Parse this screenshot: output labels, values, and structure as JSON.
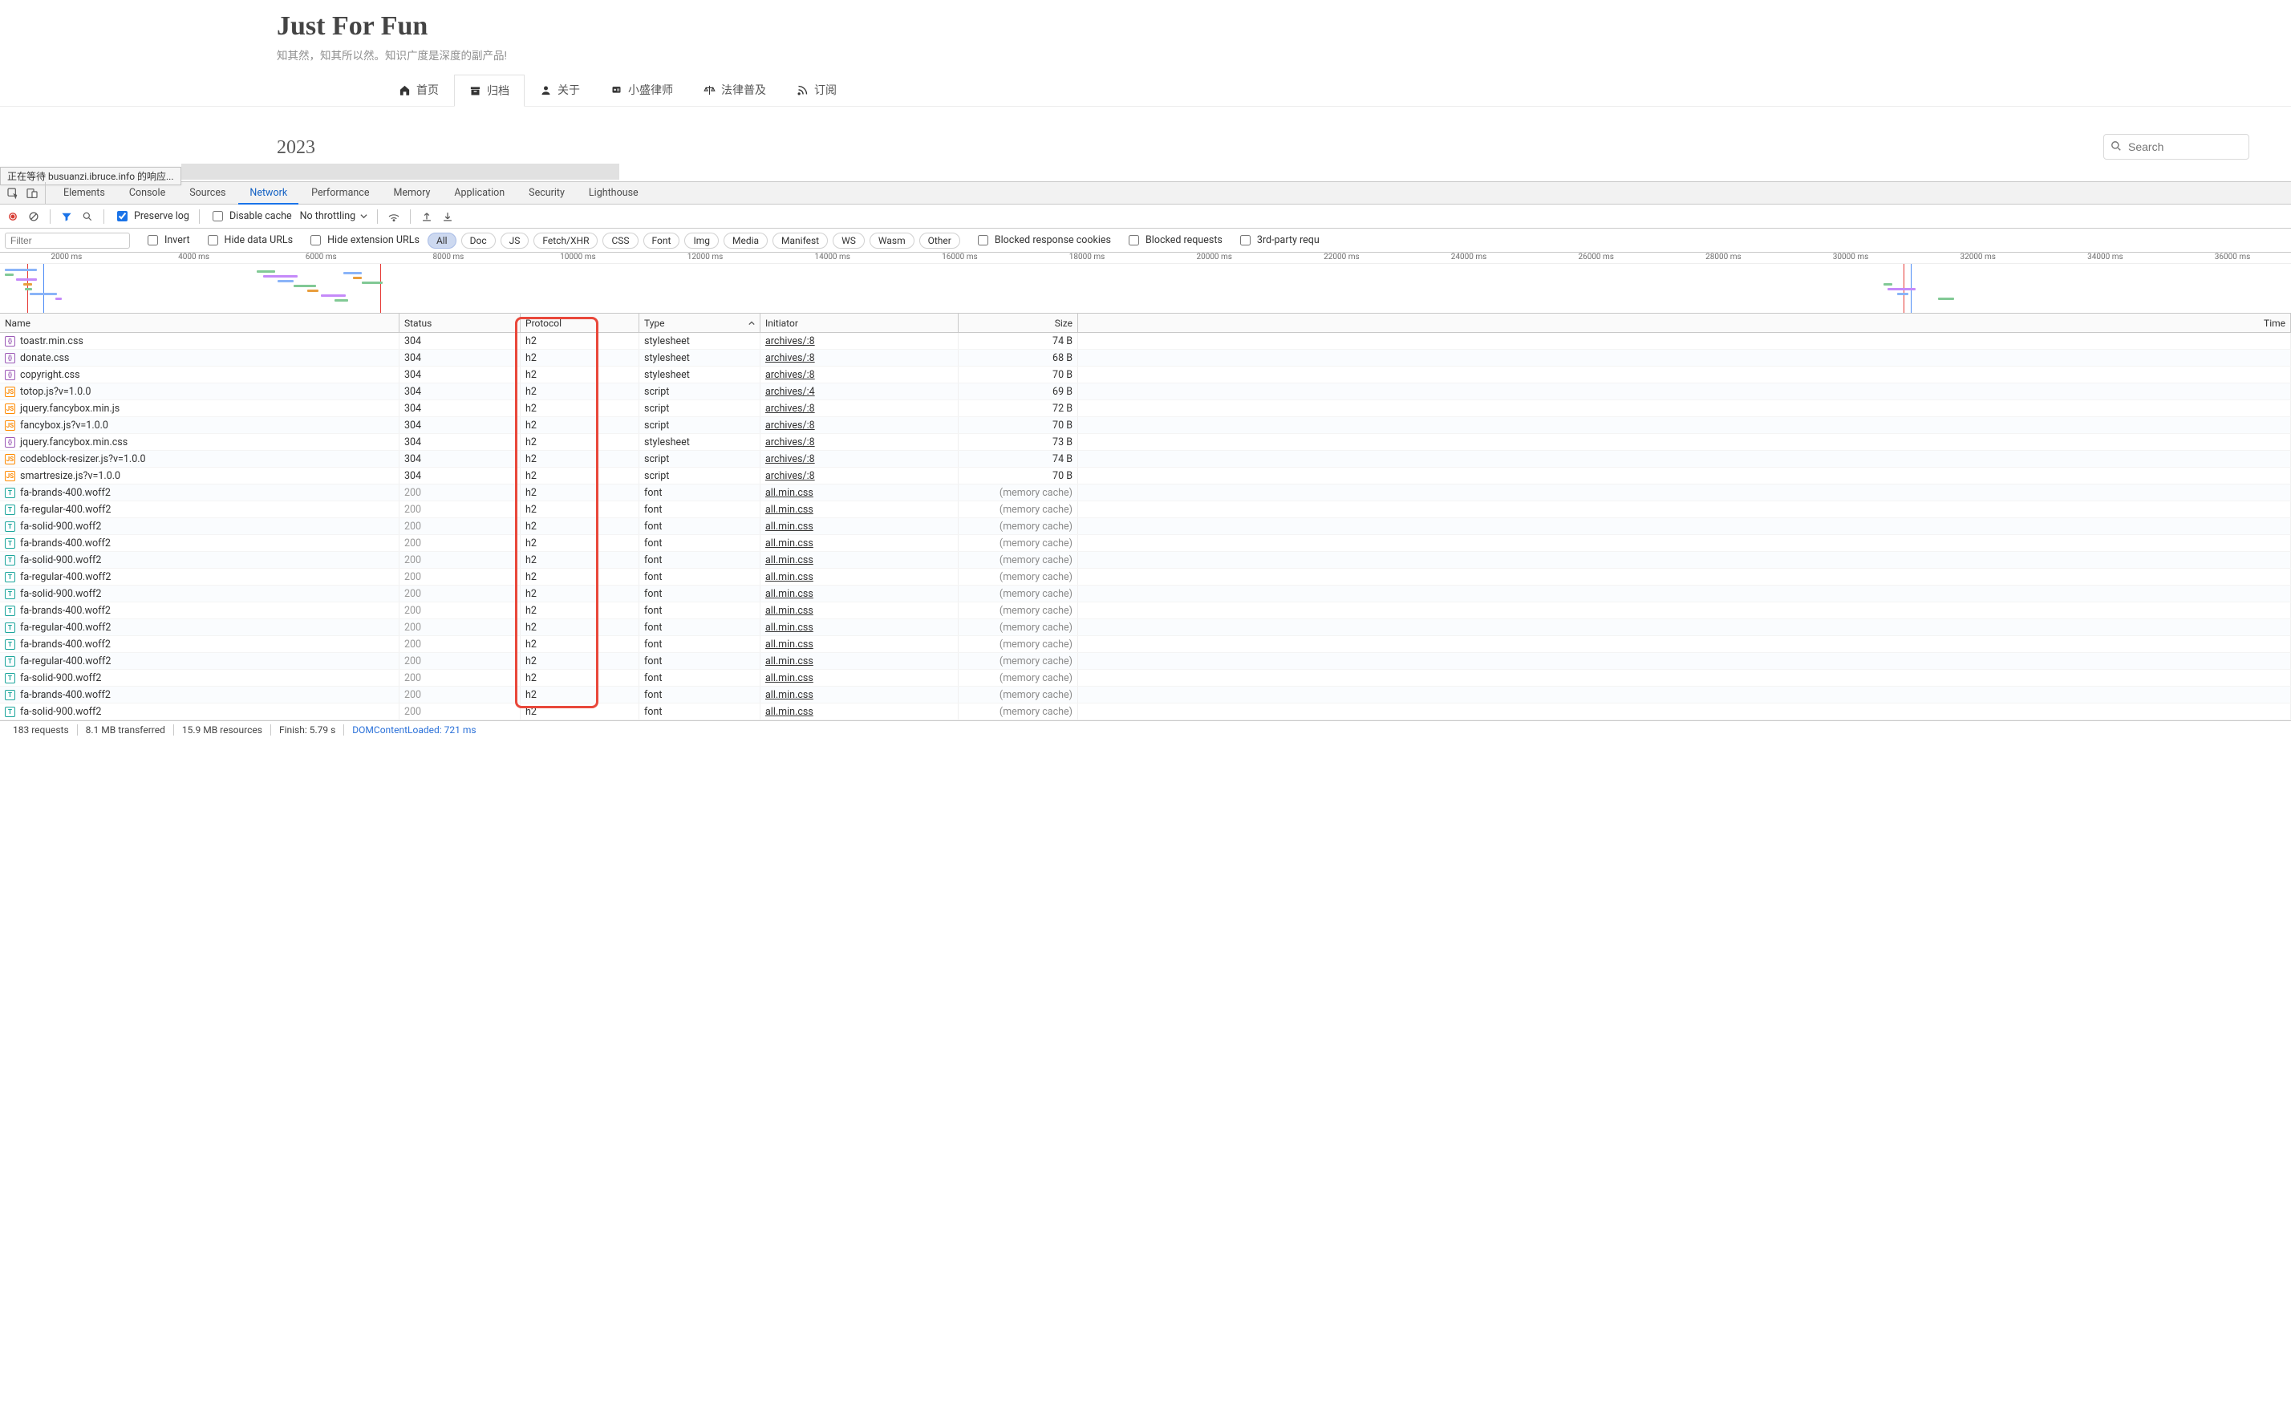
{
  "site": {
    "title": "Just For Fun",
    "subtitle": "知其然，知其所以然。知识广度是深度的副产品!"
  },
  "nav": {
    "items": [
      {
        "icon": "home",
        "label": "首页"
      },
      {
        "icon": "archive",
        "label": "归档",
        "active": true
      },
      {
        "icon": "user",
        "label": "关于"
      },
      {
        "icon": "badge",
        "label": "小盛律师"
      },
      {
        "icon": "scale",
        "label": "法律普及"
      },
      {
        "icon": "rss",
        "label": "订阅"
      }
    ]
  },
  "body": {
    "year": "2023",
    "search_placeholder": "Search"
  },
  "status_tooltip": "正在等待 busuanzi.ibruce.info 的响应...",
  "devtools": {
    "tabs": [
      "Elements",
      "Console",
      "Sources",
      "Network",
      "Performance",
      "Memory",
      "Application",
      "Security",
      "Lighthouse"
    ],
    "active_tab": "Network",
    "toolbar": {
      "preserve_log": "Preserve log",
      "disable_cache": "Disable cache",
      "throttling": "No throttling"
    },
    "filter_row": {
      "filter_placeholder": "Filter",
      "invert": "Invert",
      "hide_data_urls": "Hide data URLs",
      "hide_ext_urls": "Hide extension URLs",
      "types": [
        "All",
        "Doc",
        "JS",
        "Fetch/XHR",
        "CSS",
        "Font",
        "Img",
        "Media",
        "Manifest",
        "WS",
        "Wasm",
        "Other"
      ],
      "blocked_cookies": "Blocked response cookies",
      "blocked_requests": "Blocked requests",
      "third_party": "3rd-party requ"
    },
    "waterfall_ticks": [
      "2000 ms",
      "4000 ms",
      "6000 ms",
      "8000 ms",
      "10000 ms",
      "12000 ms",
      "14000 ms",
      "16000 ms",
      "18000 ms",
      "20000 ms",
      "22000 ms",
      "24000 ms",
      "26000 ms",
      "28000 ms",
      "30000 ms",
      "32000 ms",
      "34000 ms",
      "36000 ms"
    ],
    "columns": [
      "Name",
      "Status",
      "Protocol",
      "Type",
      "Initiator",
      "Size",
      "Time"
    ],
    "rows": [
      {
        "name": "toastr.min.css",
        "ftype": "css",
        "status": "304",
        "proto": "h2",
        "type": "stylesheet",
        "init": "archives/:8",
        "size": "74 B"
      },
      {
        "name": "donate.css",
        "ftype": "css",
        "status": "304",
        "proto": "h2",
        "type": "stylesheet",
        "init": "archives/:8",
        "size": "68 B"
      },
      {
        "name": "copyright.css",
        "ftype": "css",
        "status": "304",
        "proto": "h2",
        "type": "stylesheet",
        "init": "archives/:8",
        "size": "70 B"
      },
      {
        "name": "totop.js?v=1.0.0",
        "ftype": "js",
        "status": "304",
        "proto": "h2",
        "type": "script",
        "init": "archives/:4",
        "size": "69 B"
      },
      {
        "name": "jquery.fancybox.min.js",
        "ftype": "js",
        "status": "304",
        "proto": "h2",
        "type": "script",
        "init": "archives/:8",
        "size": "72 B"
      },
      {
        "name": "fancybox.js?v=1.0.0",
        "ftype": "js",
        "status": "304",
        "proto": "h2",
        "type": "script",
        "init": "archives/:8",
        "size": "70 B"
      },
      {
        "name": "jquery.fancybox.min.css",
        "ftype": "css",
        "status": "304",
        "proto": "h2",
        "type": "stylesheet",
        "init": "archives/:8",
        "size": "73 B"
      },
      {
        "name": "codeblock-resizer.js?v=1.0.0",
        "ftype": "js",
        "status": "304",
        "proto": "h2",
        "type": "script",
        "init": "archives/:8",
        "size": "74 B"
      },
      {
        "name": "smartresize.js?v=1.0.0",
        "ftype": "js",
        "status": "304",
        "proto": "h2",
        "type": "script",
        "init": "archives/:8",
        "size": "70 B"
      },
      {
        "name": "fa-brands-400.woff2",
        "ftype": "font",
        "status": "200",
        "proto": "h2",
        "type": "font",
        "init": "all.min.css",
        "size": "(memory cache)"
      },
      {
        "name": "fa-regular-400.woff2",
        "ftype": "font",
        "status": "200",
        "proto": "h2",
        "type": "font",
        "init": "all.min.css",
        "size": "(memory cache)"
      },
      {
        "name": "fa-solid-900.woff2",
        "ftype": "font",
        "status": "200",
        "proto": "h2",
        "type": "font",
        "init": "all.min.css",
        "size": "(memory cache)"
      },
      {
        "name": "fa-brands-400.woff2",
        "ftype": "font",
        "status": "200",
        "proto": "h2",
        "type": "font",
        "init": "all.min.css",
        "size": "(memory cache)"
      },
      {
        "name": "fa-solid-900.woff2",
        "ftype": "font",
        "status": "200",
        "proto": "h2",
        "type": "font",
        "init": "all.min.css",
        "size": "(memory cache)"
      },
      {
        "name": "fa-regular-400.woff2",
        "ftype": "font",
        "status": "200",
        "proto": "h2",
        "type": "font",
        "init": "all.min.css",
        "size": "(memory cache)"
      },
      {
        "name": "fa-solid-900.woff2",
        "ftype": "font",
        "status": "200",
        "proto": "h2",
        "type": "font",
        "init": "all.min.css",
        "size": "(memory cache)"
      },
      {
        "name": "fa-brands-400.woff2",
        "ftype": "font",
        "status": "200",
        "proto": "h2",
        "type": "font",
        "init": "all.min.css",
        "size": "(memory cache)"
      },
      {
        "name": "fa-regular-400.woff2",
        "ftype": "font",
        "status": "200",
        "proto": "h2",
        "type": "font",
        "init": "all.min.css",
        "size": "(memory cache)"
      },
      {
        "name": "fa-brands-400.woff2",
        "ftype": "font",
        "status": "200",
        "proto": "h2",
        "type": "font",
        "init": "all.min.css",
        "size": "(memory cache)"
      },
      {
        "name": "fa-regular-400.woff2",
        "ftype": "font",
        "status": "200",
        "proto": "h2",
        "type": "font",
        "init": "all.min.css",
        "size": "(memory cache)"
      },
      {
        "name": "fa-solid-900.woff2",
        "ftype": "font",
        "status": "200",
        "proto": "h2",
        "type": "font",
        "init": "all.min.css",
        "size": "(memory cache)"
      },
      {
        "name": "fa-brands-400.woff2",
        "ftype": "font",
        "status": "200",
        "proto": "h2",
        "type": "font",
        "init": "all.min.css",
        "size": "(memory cache)"
      },
      {
        "name": "fa-solid-900.woff2",
        "ftype": "font",
        "status": "200",
        "proto": "h2",
        "type": "font",
        "init": "all.min.css",
        "size": "(memory cache)"
      }
    ],
    "footer": {
      "requests": "183 requests",
      "transferred": "8.1 MB transferred",
      "resources": "15.9 MB resources",
      "finish": "Finish: 5.79 s",
      "dcl": "DOMContentLoaded: 721 ms"
    }
  }
}
